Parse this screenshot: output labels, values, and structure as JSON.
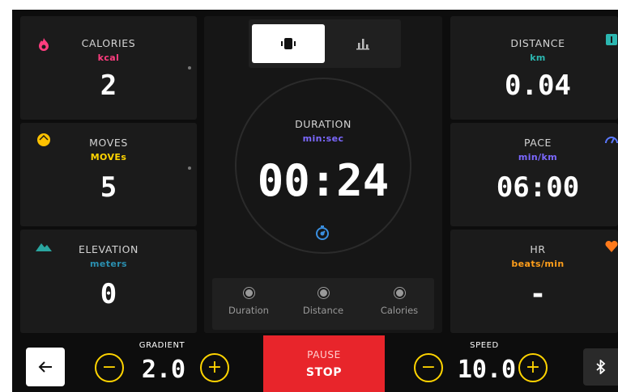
{
  "tiles": {
    "calories": {
      "label": "CALORIES",
      "unit": "kcal",
      "value": "2",
      "icon": "flame-icon",
      "unit_color": "#ff3d7f"
    },
    "moves": {
      "label": "MOVES",
      "unit": "MOVEs",
      "value": "5",
      "icon": "moves-icon",
      "unit_color": "#ffd400"
    },
    "elevation": {
      "label": "ELEVATION",
      "unit": "meters",
      "value": "0",
      "icon": "mountain-icon",
      "unit_color": "#2a8fb0"
    },
    "distance": {
      "label": "DISTANCE",
      "unit": "km",
      "value": "0.04",
      "icon": "distance-icon",
      "unit_color": "#2bb6b0"
    },
    "pace": {
      "label": "PACE",
      "unit": "min/km",
      "value": "06:00",
      "icon": "speedometer-icon",
      "unit_color": "#7b68ff"
    },
    "hr": {
      "label": "HR",
      "unit": "beats/min",
      "value": "-",
      "icon": "heart-icon",
      "unit_color": "#ff9e1b"
    }
  },
  "view_toggle": {
    "selected": "timer-view",
    "options": [
      "timer-view-icon",
      "chart-view-icon"
    ]
  },
  "center": {
    "label": "DURATION",
    "unit": "min:sec",
    "value": "00:24",
    "icon": "timer-icon",
    "unit_color": "#7b68ff"
  },
  "selectors": [
    "Duration",
    "Distance",
    "Calories"
  ],
  "bottom": {
    "gradient": {
      "label": "GRADIENT",
      "value": "2.0"
    },
    "speed": {
      "label": "SPEED",
      "value": "10.0"
    },
    "pause_label": "PAUSE",
    "stop_label": "STOP",
    "minus": "−",
    "plus": "+"
  },
  "colors": {
    "accent": "#ffd400",
    "stop": "#e8252b",
    "background": "#0d0d0d",
    "tile": "#1b1b1b"
  }
}
